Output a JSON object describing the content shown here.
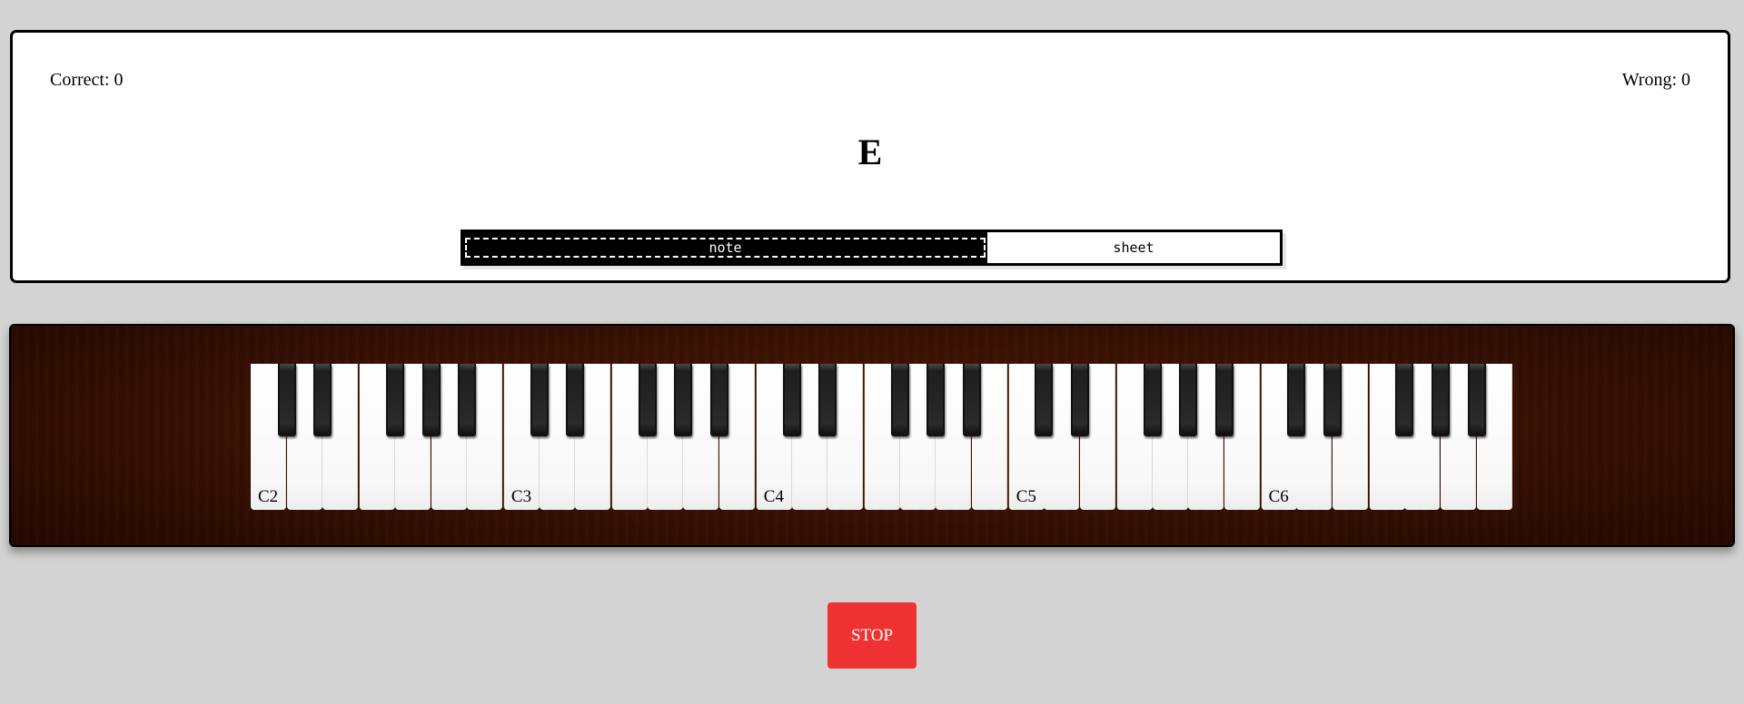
{
  "quiz": {
    "correct_label": "Correct: 0",
    "wrong_label": "Wrong: 0",
    "current_note": "E"
  },
  "mode_toggle": {
    "options": [
      {
        "label": "note",
        "selected": true
      },
      {
        "label": "sheet",
        "selected": false
      }
    ]
  },
  "keyboard": {
    "octave_labels": [
      "C2",
      "C3",
      "C4",
      "C5",
      "C6"
    ],
    "white_key_count": 35,
    "black_key_count": 25
  },
  "controls": {
    "stop_label": "STOP"
  },
  "colors": {
    "page_background": "#d3d3d3",
    "stop_button": "#ee3232",
    "piano_wood": "#3a1102"
  }
}
